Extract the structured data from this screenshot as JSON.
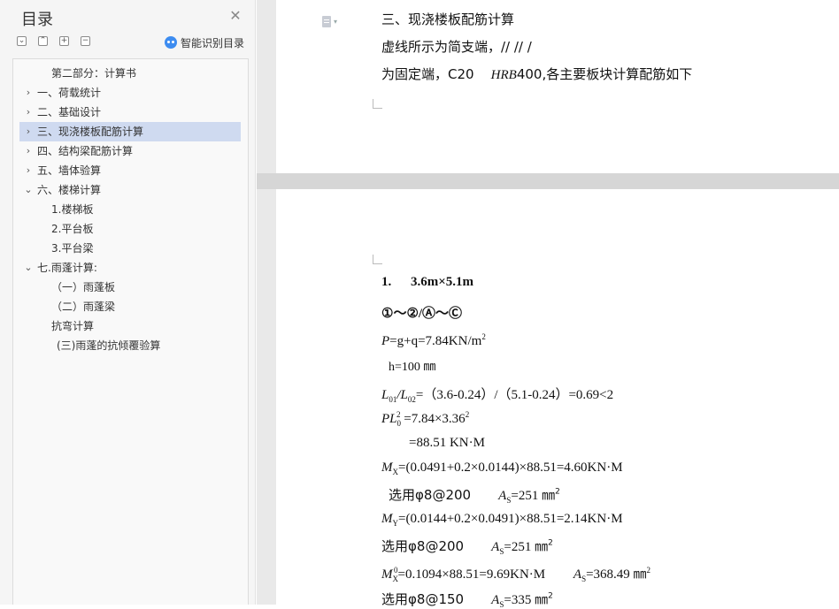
{
  "sidebar": {
    "title": "目录",
    "close_icon": "close-icon",
    "toolbar": {
      "collapse_all": "⌄",
      "expand_level": "⌃",
      "add": "+",
      "remove": "−"
    },
    "smart_toc_label": "智能识别目录",
    "items": [
      {
        "label": "第二部分：计算书",
        "chevron": ""
      },
      {
        "label": "一、荷载统计",
        "chevron": "›"
      },
      {
        "label": "二、基础设计",
        "chevron": "›"
      },
      {
        "label": "三、现浇楼板配筋计算",
        "chevron": "›",
        "selected": true
      },
      {
        "label": "四、结构梁配筋计算",
        "chevron": "›"
      },
      {
        "label": "五、墙体验算",
        "chevron": "›"
      },
      {
        "label": "六、楼梯计算",
        "chevron": "⌄"
      },
      {
        "label": "1.楼梯板",
        "chevron": ""
      },
      {
        "label": "2.平台板",
        "chevron": ""
      },
      {
        "label": "3.平台梁",
        "chevron": ""
      },
      {
        "label": "七.雨蓬计算:",
        "chevron": "⌄"
      },
      {
        "label": "（一）雨蓬板",
        "chevron": ""
      },
      {
        "label": "（二）雨蓬梁",
        "chevron": ""
      },
      {
        "label": "抗弯计算",
        "chevron": ""
      },
      {
        "label": "(三)雨蓬的抗倾覆验算",
        "chevron": ""
      }
    ]
  },
  "document": {
    "page1": {
      "heading": "三、现浇楼板配筋计算",
      "line2": "虚线所示为简支端，// // /",
      "line3_a": "为固定端，C20",
      "line3_b": "HRB",
      "line3_c": "400,各主要板块计算配筋如下"
    },
    "page2": {
      "section_num": "1.",
      "section_title": "3.6m×5.1m",
      "grid": "①～②/Ⓐ～Ⓒ",
      "l_p": "P",
      "l_p_rest": "=g+q=7.84KN/m",
      "l_p_sup": "2",
      "l_h": "h=100 ㎜",
      "l_ratio_a": "L",
      "l_ratio_sub1": "01",
      "l_ratio_b": "/L",
      "l_ratio_sub2": "02",
      "l_ratio_c": "=（3.6-0.24）/（5.1-0.24）=0.69<2",
      "l_pl_a": "PL",
      "l_pl_sub": "0",
      "l_pl_sup": "2",
      "l_pl_b": " =7.84×3.36",
      "l_pl_sup2": "2",
      "l_pl_result": "=88.51 KN·M",
      "l_mx_a": "M",
      "l_mx_sub": "X",
      "l_mx_b": "=(0.0491+0.2×0.0144)×88.51=4.60KN·M",
      "l_sel1_a": "选用φ8@200",
      "l_sel1_b": "A",
      "l_sel1_sub": "S",
      "l_sel1_c": "=251 ㎜",
      "l_sel1_sup": "2",
      "l_my_a": "M",
      "l_my_sub": "Y",
      "l_my_b": "=(0.0144+0.2×0.0491)×88.51=2.14KN·M",
      "l_sel2_a": "选用φ8@200",
      "l_sel2_b": "A",
      "l_sel2_sub": "S",
      "l_sel2_c": "=251 ㎜",
      "l_sel2_sup": "2",
      "l_mx0_a": "M",
      "l_mx0_sub": "X",
      "l_mx0_sup": "0",
      "l_mx0_b": "=0.1094×88.51=9.69KN·M",
      "l_mx0_c": "A",
      "l_mx0_sub2": "S",
      "l_mx0_d": "=368.49 ㎜",
      "l_mx0_sup2": "2",
      "l_sel3_a": "选用φ8@150",
      "l_sel3_b": "A",
      "l_sel3_sub": "S",
      "l_sel3_c": "=335 ㎜",
      "l_sel3_sup": "2"
    }
  }
}
